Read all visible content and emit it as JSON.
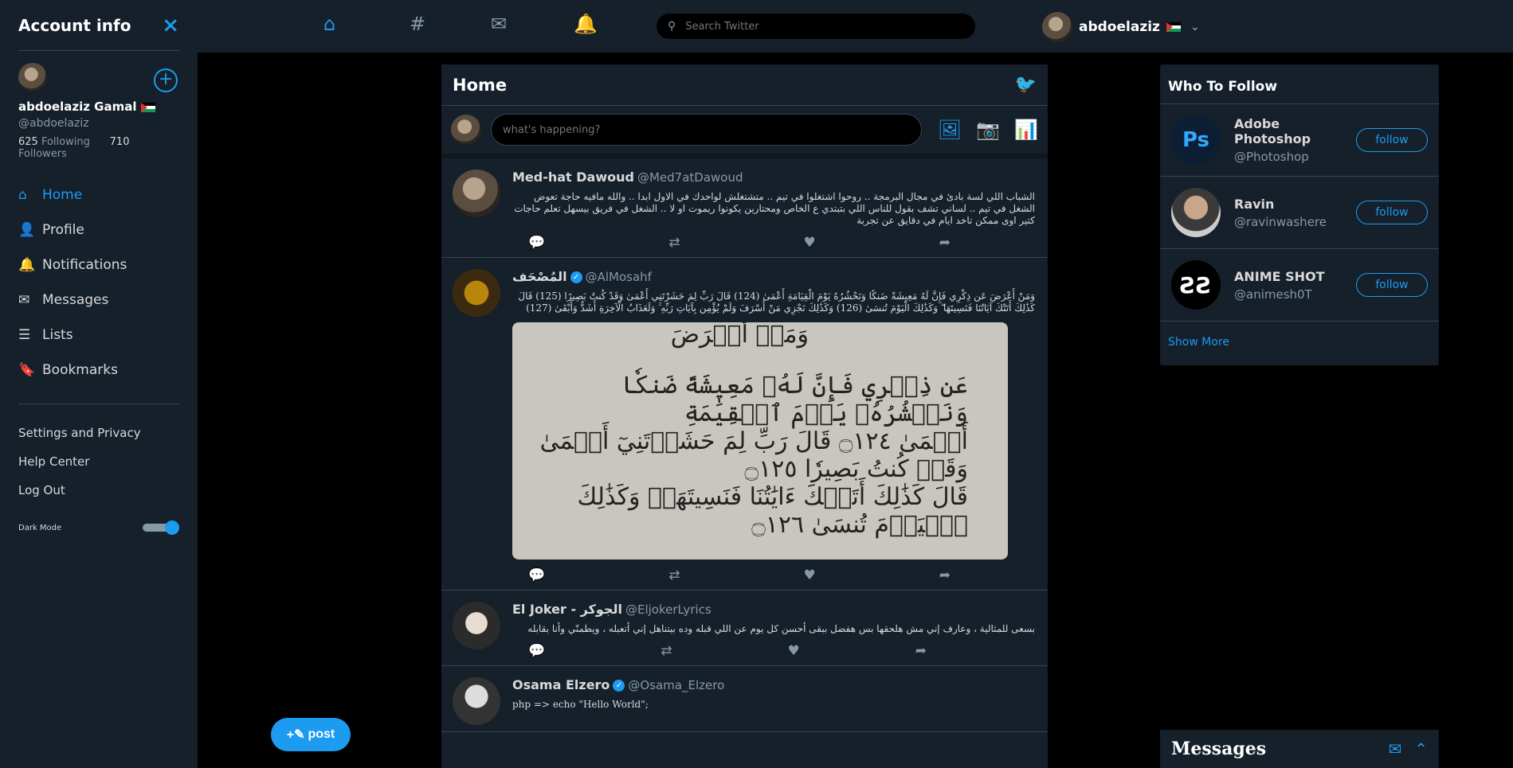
{
  "sidebar": {
    "title": "Account info",
    "close_icon": "×",
    "user": {
      "name": "abdoelaziz Gamal",
      "handle": "@abdoelaziz",
      "following_count": "625",
      "following_label": "Following",
      "followers_count": "710",
      "followers_label": "Followers"
    },
    "nav": [
      {
        "label": "Home",
        "icon": "home-icon",
        "active": true
      },
      {
        "label": "Profile",
        "icon": "user-icon"
      },
      {
        "label": "Notifications",
        "icon": "bell-icon"
      },
      {
        "label": "Messages",
        "icon": "envelope-icon"
      },
      {
        "label": "Lists",
        "icon": "list-icon"
      },
      {
        "label": "Bookmarks",
        "icon": "bookmark-icon"
      }
    ],
    "sub": [
      "Settings and Privacy",
      "Help Center",
      "Log Out"
    ],
    "dark_mode_label": "Dark Mode",
    "dark_mode_on": true
  },
  "post_button": "post",
  "topbar": {
    "search_placeholder": "Search Twitter",
    "username": "abdoelaziz"
  },
  "feed": {
    "title": "Home",
    "compose_placeholder": "what's happening?",
    "tweets": [
      {
        "name": "Med-hat Dawoud",
        "handle": "@Med7atDawoud",
        "text": "الشباب اللي لسة بادئ في مجال البرمجة .. روحوا اشتغلوا في تيم .. متشتغلش لواحدك في الاول ابدا .. والله مافيه حاجة تعوض الشغل في تيم .. لساني تشف بقول للناس اللي بتبتدي ع الخاص ومحتارين يكونوا ريموت او لا .. الشغل في فريق بيسهل تعلم حاجات كتير اوى ممكن تاخد ايام في دقايق عن تجربة"
      },
      {
        "name": "المُصْحَف",
        "handle": "@AlMosahf",
        "text": "وَمَنْ أَعْرَضَ عَن ذِكْرِي فَإِنَّ لَهُ مَعِيشَةً ضَنكًا وَنَحْشُرُهُ يَوْمَ الْقِيَامَةِ أَعْمَىٰ (124) قَالَ رَبِّ لِمَ حَشَرْتَنِي أَعْمَىٰ وَقَدْ كُنتُ بَصِيرًا (125) قَالَ كَذَٰلِكَ أَتَتْكَ آيَاتُنَا فَنَسِيتَهَا ۖ وَكَذَٰلِكَ الْيَوْمَ تُنسَىٰ (126) وَكَذَٰلِكَ نَجْزِي مَنْ أَسْرَفَ وَلَمْ يُؤْمِن بِآيَاتِ رَبِّهِ ۚ وَلَعَذَابُ الْآخِرَةِ أَشَدُّ وَأَبْقَىٰ (127)",
        "image_lines": [
          "وَمَنۡ أَعۡرَضَ",
          "عَن ذِكۡرِي فَإِنَّ لَهُۥ مَعِيشَةً ضَنكٗا وَنَحۡشُرُهُۥ يَوۡمَ ٱلۡقِيَٰمَةِ",
          "أَعۡمَىٰ ۝١٢٤ قَالَ رَبِّ لِمَ حَشَرۡتَنِيٓ أَعۡمَىٰ وَقَدۡ كُنتُ بَصِيرٗا ۝١٢٥",
          "قَالَ كَذَٰلِكَ أَتَتۡكَ ءَايَٰتُنَا فَنَسِيتَهَاۖ وَكَذَٰلِكَ ٱلۡيَوۡمَ تُنسَىٰ ۝١٢٦"
        ]
      },
      {
        "name": "El Joker - الجوكر",
        "handle": "@EljokerLyrics",
        "text": "بسعى للمثالية ، وعارف إني مش هلحقها بس هفضل ببقى أحسن كل يوم عن اللي قبله وده بيتناهل إني أتعبله ، ويطمنّي وأنا بقابله"
      },
      {
        "name": "Osama Elzero",
        "handle": "@Osama_Elzero",
        "text": "php => echo \"Hello World\";"
      }
    ]
  },
  "who_to_follow": {
    "title": "Who To Follow",
    "items": [
      {
        "name": "Adobe Photoshop",
        "handle": "@Photoshop",
        "button": "follow",
        "logo": "Ps"
      },
      {
        "name": "Ravin",
        "handle": "@ravinwashere",
        "button": "follow"
      },
      {
        "name": "ANIME SHOT",
        "handle": "@animesh0T",
        "button": "follow",
        "logo": "ƧƧ"
      }
    ],
    "show_more": "Show More"
  },
  "messages": {
    "title": "Messages"
  },
  "colors": {
    "accent": "#1d9bf0",
    "panel": "#15202b",
    "background": "#000000"
  }
}
